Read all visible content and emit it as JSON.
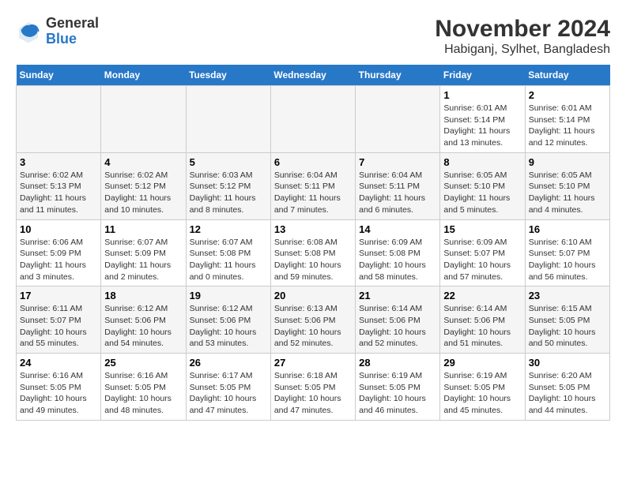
{
  "logo": {
    "general": "General",
    "blue": "Blue"
  },
  "title": "November 2024",
  "subtitle": "Habiganj, Sylhet, Bangladesh",
  "headers": [
    "Sunday",
    "Monday",
    "Tuesday",
    "Wednesday",
    "Thursday",
    "Friday",
    "Saturday"
  ],
  "weeks": [
    [
      {
        "day": "",
        "info": ""
      },
      {
        "day": "",
        "info": ""
      },
      {
        "day": "",
        "info": ""
      },
      {
        "day": "",
        "info": ""
      },
      {
        "day": "",
        "info": ""
      },
      {
        "day": "1",
        "info": "Sunrise: 6:01 AM\nSunset: 5:14 PM\nDaylight: 11 hours and 13 minutes."
      },
      {
        "day": "2",
        "info": "Sunrise: 6:01 AM\nSunset: 5:14 PM\nDaylight: 11 hours and 12 minutes."
      }
    ],
    [
      {
        "day": "3",
        "info": "Sunrise: 6:02 AM\nSunset: 5:13 PM\nDaylight: 11 hours and 11 minutes."
      },
      {
        "day": "4",
        "info": "Sunrise: 6:02 AM\nSunset: 5:12 PM\nDaylight: 11 hours and 10 minutes."
      },
      {
        "day": "5",
        "info": "Sunrise: 6:03 AM\nSunset: 5:12 PM\nDaylight: 11 hours and 8 minutes."
      },
      {
        "day": "6",
        "info": "Sunrise: 6:04 AM\nSunset: 5:11 PM\nDaylight: 11 hours and 7 minutes."
      },
      {
        "day": "7",
        "info": "Sunrise: 6:04 AM\nSunset: 5:11 PM\nDaylight: 11 hours and 6 minutes."
      },
      {
        "day": "8",
        "info": "Sunrise: 6:05 AM\nSunset: 5:10 PM\nDaylight: 11 hours and 5 minutes."
      },
      {
        "day": "9",
        "info": "Sunrise: 6:05 AM\nSunset: 5:10 PM\nDaylight: 11 hours and 4 minutes."
      }
    ],
    [
      {
        "day": "10",
        "info": "Sunrise: 6:06 AM\nSunset: 5:09 PM\nDaylight: 11 hours and 3 minutes."
      },
      {
        "day": "11",
        "info": "Sunrise: 6:07 AM\nSunset: 5:09 PM\nDaylight: 11 hours and 2 minutes."
      },
      {
        "day": "12",
        "info": "Sunrise: 6:07 AM\nSunset: 5:08 PM\nDaylight: 11 hours and 0 minutes."
      },
      {
        "day": "13",
        "info": "Sunrise: 6:08 AM\nSunset: 5:08 PM\nDaylight: 10 hours and 59 minutes."
      },
      {
        "day": "14",
        "info": "Sunrise: 6:09 AM\nSunset: 5:08 PM\nDaylight: 10 hours and 58 minutes."
      },
      {
        "day": "15",
        "info": "Sunrise: 6:09 AM\nSunset: 5:07 PM\nDaylight: 10 hours and 57 minutes."
      },
      {
        "day": "16",
        "info": "Sunrise: 6:10 AM\nSunset: 5:07 PM\nDaylight: 10 hours and 56 minutes."
      }
    ],
    [
      {
        "day": "17",
        "info": "Sunrise: 6:11 AM\nSunset: 5:07 PM\nDaylight: 10 hours and 55 minutes."
      },
      {
        "day": "18",
        "info": "Sunrise: 6:12 AM\nSunset: 5:06 PM\nDaylight: 10 hours and 54 minutes."
      },
      {
        "day": "19",
        "info": "Sunrise: 6:12 AM\nSunset: 5:06 PM\nDaylight: 10 hours and 53 minutes."
      },
      {
        "day": "20",
        "info": "Sunrise: 6:13 AM\nSunset: 5:06 PM\nDaylight: 10 hours and 52 minutes."
      },
      {
        "day": "21",
        "info": "Sunrise: 6:14 AM\nSunset: 5:06 PM\nDaylight: 10 hours and 52 minutes."
      },
      {
        "day": "22",
        "info": "Sunrise: 6:14 AM\nSunset: 5:06 PM\nDaylight: 10 hours and 51 minutes."
      },
      {
        "day": "23",
        "info": "Sunrise: 6:15 AM\nSunset: 5:05 PM\nDaylight: 10 hours and 50 minutes."
      }
    ],
    [
      {
        "day": "24",
        "info": "Sunrise: 6:16 AM\nSunset: 5:05 PM\nDaylight: 10 hours and 49 minutes."
      },
      {
        "day": "25",
        "info": "Sunrise: 6:16 AM\nSunset: 5:05 PM\nDaylight: 10 hours and 48 minutes."
      },
      {
        "day": "26",
        "info": "Sunrise: 6:17 AM\nSunset: 5:05 PM\nDaylight: 10 hours and 47 minutes."
      },
      {
        "day": "27",
        "info": "Sunrise: 6:18 AM\nSunset: 5:05 PM\nDaylight: 10 hours and 47 minutes."
      },
      {
        "day": "28",
        "info": "Sunrise: 6:19 AM\nSunset: 5:05 PM\nDaylight: 10 hours and 46 minutes."
      },
      {
        "day": "29",
        "info": "Sunrise: 6:19 AM\nSunset: 5:05 PM\nDaylight: 10 hours and 45 minutes."
      },
      {
        "day": "30",
        "info": "Sunrise: 6:20 AM\nSunset: 5:05 PM\nDaylight: 10 hours and 44 minutes."
      }
    ]
  ]
}
